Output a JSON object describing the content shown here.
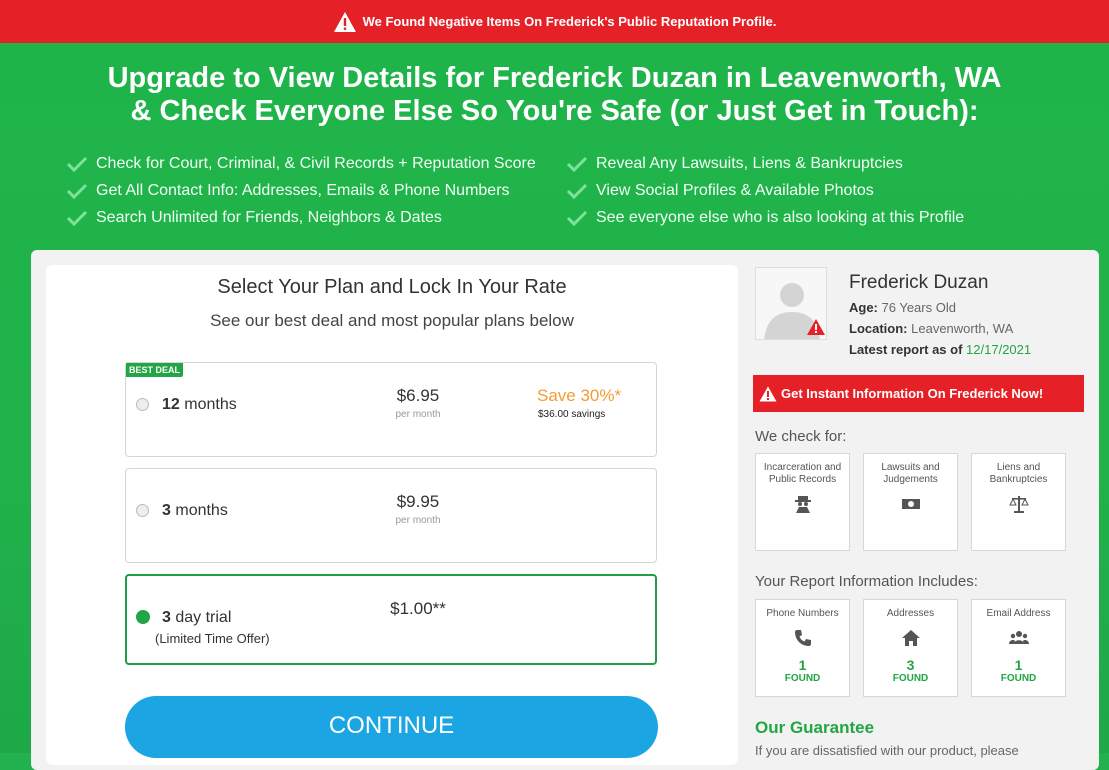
{
  "topbar": {
    "message": "We Found Negative Items On Frederick's Public Reputation Profile."
  },
  "headline": {
    "line1": "Upgrade to View Details for Frederick Duzan in Leavenworth, WA",
    "line2": "& Check Everyone Else So You're Safe (or Just Get in Touch):"
  },
  "bullets": [
    "Check for Court, Criminal, & Civil Records + Reputation Score",
    "Reveal Any Lawsuits, Liens & Bankruptcies",
    "Get All Contact Info: Addresses, Emails & Phone Numbers",
    "View Social Profiles & Available Photos",
    "Search Unlimited for Friends, Neighbors & Dates",
    "See everyone else who is also looking at this Profile"
  ],
  "plans": {
    "title": "Select Your Plan and Lock In Your Rate",
    "subtitle": "See our best deal and most popular plans below",
    "options": [
      {
        "badge": "BEST DEAL",
        "qty": "12",
        "unit": "months",
        "price": "$6.95",
        "per": "per month",
        "save": "Save 30%*",
        "savings": "$36.00 savings",
        "selected": false
      },
      {
        "qty": "3",
        "unit": "months",
        "price": "$9.95",
        "per": "per month",
        "selected": false
      },
      {
        "qty": "3",
        "unit": "day trial",
        "price": "$1.00**",
        "note": "(Limited Time Offer)",
        "selected": true
      }
    ],
    "continue_label": "CONTINUE"
  },
  "profile": {
    "name": "Frederick Duzan",
    "age_label": "Age:",
    "age_value": "76 Years Old",
    "location_label": "Location:",
    "location_value": "Leavenworth, WA",
    "report_label": "Latest report as of",
    "report_date": "12/17/2021"
  },
  "instant_info": "Get Instant Information On Frederick Now!",
  "we_check": {
    "title": "We check for:",
    "items": [
      {
        "label": "Incarceration and Public Records",
        "icon": "spy-icon"
      },
      {
        "label": "Lawsuits and Judgements",
        "icon": "money-icon"
      },
      {
        "label": "Liens and Bankruptcies",
        "icon": "scale-icon"
      }
    ]
  },
  "report_includes": {
    "title": "Your Report Information Includes:",
    "items": [
      {
        "label": "Phone Numbers",
        "icon": "phone-icon",
        "count": "1",
        "found": "FOUND"
      },
      {
        "label": "Addresses",
        "icon": "home-icon",
        "count": "3",
        "found": "FOUND"
      },
      {
        "label": "Email Address",
        "icon": "users-icon",
        "count": "1",
        "found": "FOUND"
      }
    ]
  },
  "guarantee": {
    "title": "Our Guarantee",
    "text": "If you are dissatisfied with our product, please"
  },
  "colors": {
    "green": "#22b14c",
    "red": "#e52127",
    "blue": "#1ca5e3",
    "orange": "#f39c34"
  }
}
